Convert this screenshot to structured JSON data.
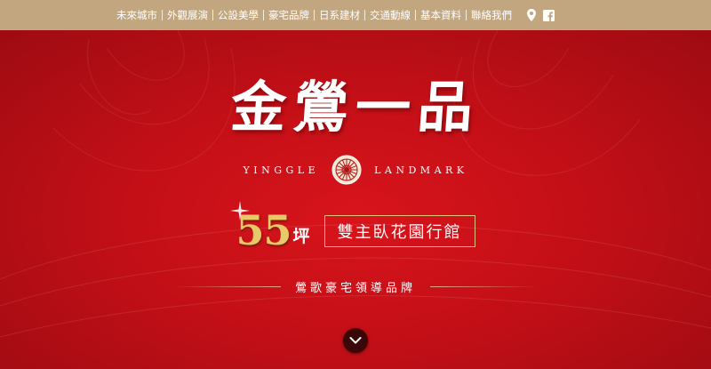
{
  "nav": {
    "items": [
      {
        "label": "未來城市"
      },
      {
        "label": "外觀展演"
      },
      {
        "label": "公設美學"
      },
      {
        "label": "豪宅品牌"
      },
      {
        "label": "日系建材"
      },
      {
        "label": "交通動線"
      },
      {
        "label": "基本資料"
      },
      {
        "label": "聯絡我們"
      }
    ],
    "icons": [
      "map-pin-icon",
      "facebook-icon"
    ]
  },
  "hero": {
    "logo_zh": "金鶯一品",
    "logo_en_left": "YINGGLE",
    "logo_en_right": "LANDMARK",
    "size_number": "55",
    "size_unit": "坪",
    "feature": "雙主臥花園行館",
    "tagline": "鶯歌豪宅領導品牌"
  },
  "colors": {
    "topbar": "#c2a67f",
    "hero_red": "#c40f17",
    "gold": "#e8c96a",
    "button_dark": "#3a0608"
  }
}
